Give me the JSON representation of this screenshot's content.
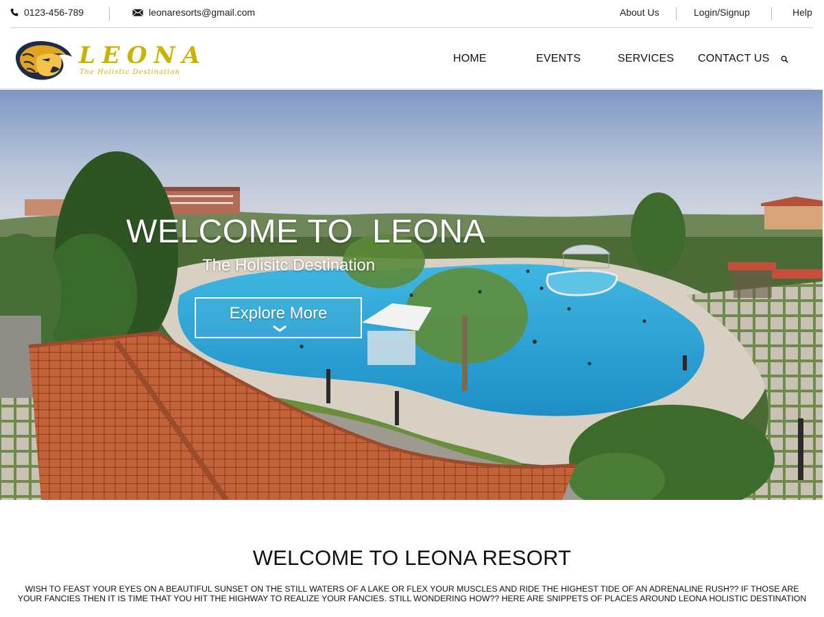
{
  "topbar": {
    "phone": "0123-456-789",
    "email": "leonaresorts@gmail.com",
    "links": [
      "About Us",
      "Login/Signup",
      "Help"
    ]
  },
  "header": {
    "logo_text": "LEONA",
    "logo_tagline": "The Holistic Destination",
    "nav": [
      "HOME",
      "EVENTS",
      "SERVICES",
      "CONTACT US"
    ],
    "search_icon": "search-icon"
  },
  "hero": {
    "title": "WELCOME TO  LEONA",
    "subtitle": "The Holisitc Destination",
    "button_label": "Explore More",
    "button_icon": "chevron-down-icon"
  },
  "intro": {
    "title": "WELCOME TO LEONA RESORT",
    "text": "WISH TO FEAST YOUR EYES ON A BEAUTIFUL SUNSET ON THE STILL WATERS OF A LAKE OR FLEX YOUR MUSCLES AND RIDE THE HIGHEST TIDE OF AN ADRENALINE RUSH?? IF THOSE ARE YOUR FANCIES THEN IT IS TIME THAT YOU HIT THE HIGHWAY TO REALIZE YOUR FANCIES. STILL WONDERING HOW?? HERE ARE SNIPPETS OF PLACES AROUND LEONA HOLISTIC DESTINATION"
  },
  "colors": {
    "logo_gold": "#c8b400",
    "pool_blue": "#2ea5d6",
    "roof_terracotta": "#c4623a"
  }
}
